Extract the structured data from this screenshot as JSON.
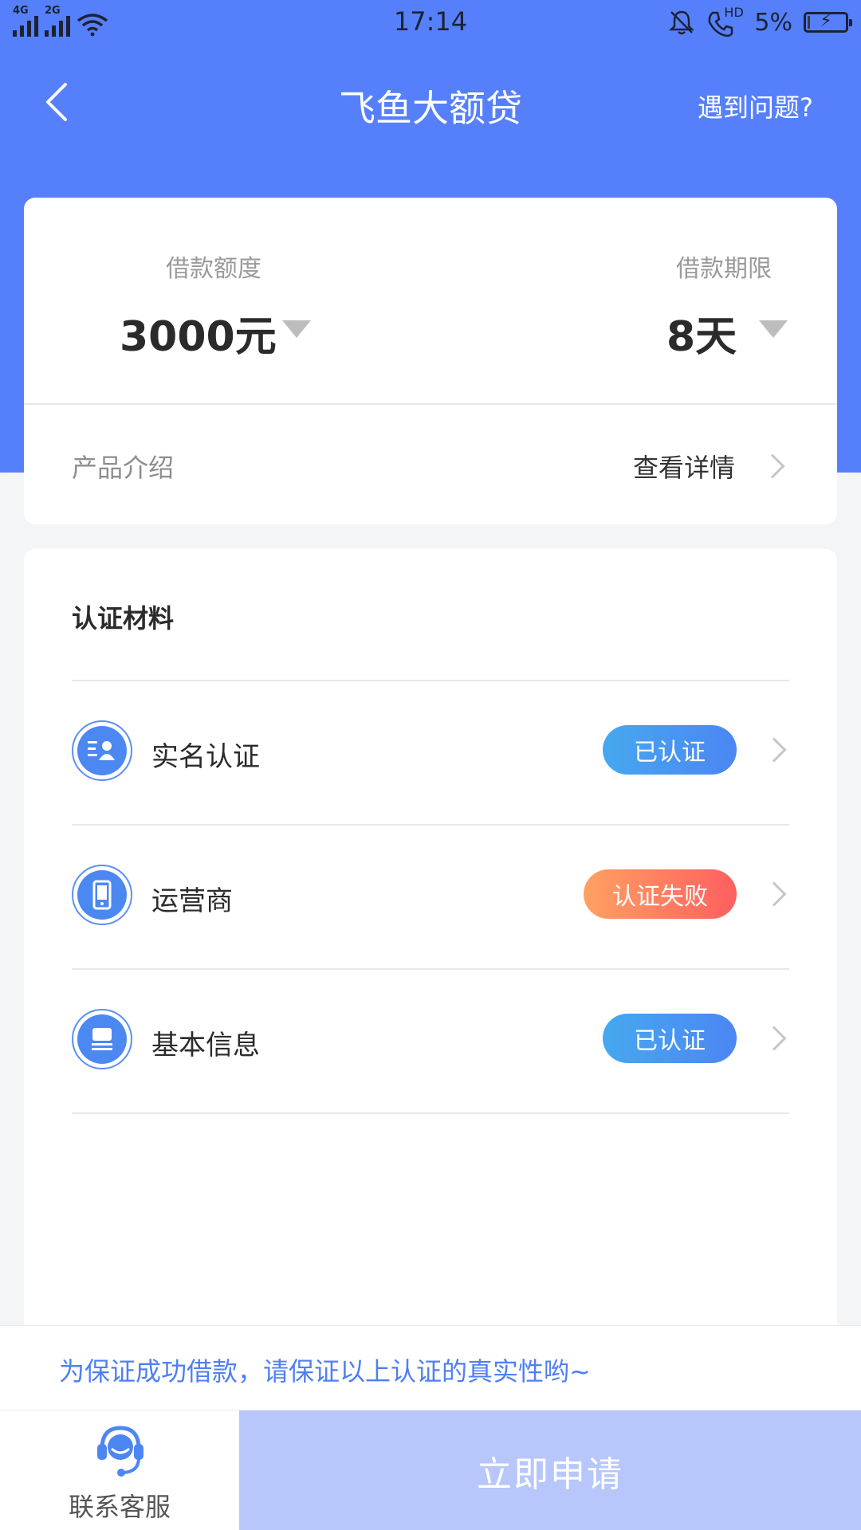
{
  "status_bar": {
    "signal1_label": "4G",
    "signal2_label": "2G",
    "time": "17:14",
    "call_label": "HD",
    "battery": "5%"
  },
  "nav": {
    "title": "飞鱼大额贷",
    "help": "遇到问题?"
  },
  "loan": {
    "amount_label": "借款额度",
    "amount_value": "3000元",
    "term_label": "借款期限",
    "term_value": "8天"
  },
  "product": {
    "label": "产品介绍",
    "link": "查看详情"
  },
  "certification": {
    "title": "认证材料",
    "items": [
      {
        "label": "实名认证",
        "status": "已认证",
        "icon": "id-card-icon"
      },
      {
        "label": "运营商",
        "status": "认证失败",
        "icon": "phone-icon"
      },
      {
        "label": "基本信息",
        "status": "已认证",
        "icon": "info-card-icon"
      }
    ]
  },
  "notice": "为保证成功借款，请保证以上认证的真实性哟~",
  "bottom": {
    "customer_service": "联系客服",
    "apply": "立即申请"
  },
  "colors": {
    "primary": "#5680fb",
    "success_badge": "#4c86f3",
    "fail_badge": "#ff6f5f",
    "apply_button": "#b7c7fb",
    "notice_text": "#4f7ff2"
  }
}
